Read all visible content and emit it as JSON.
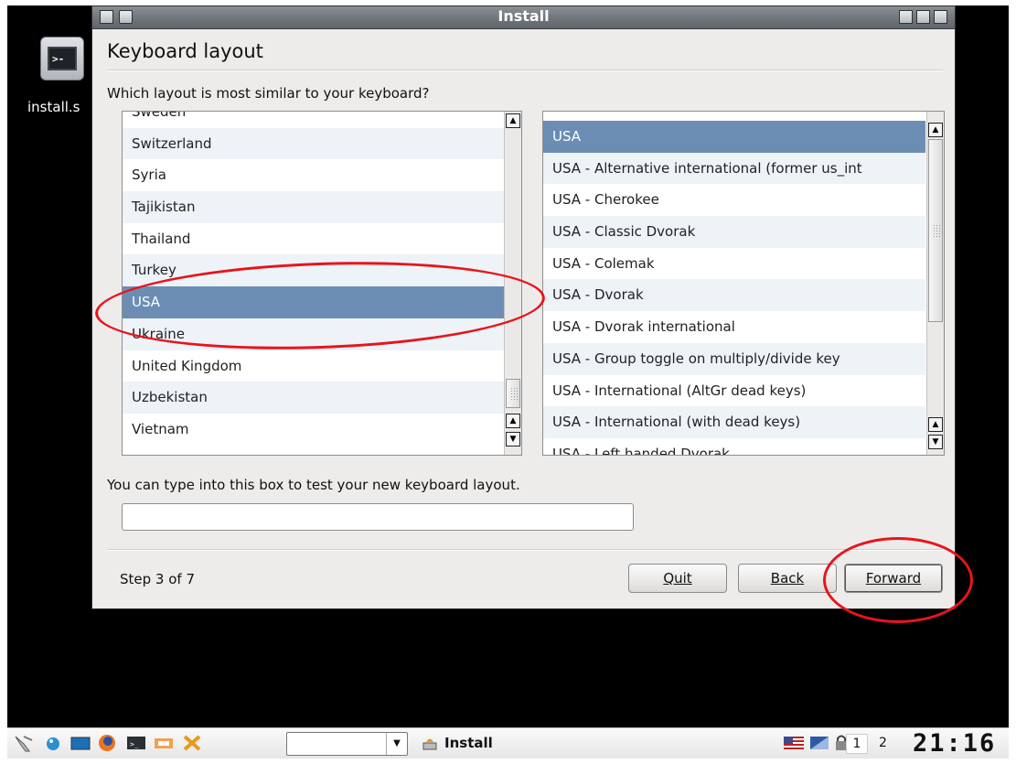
{
  "desktop": {
    "icon_label": "install.s",
    "icon_glyph": ">-"
  },
  "window": {
    "title": "Install",
    "heading": "Keyboard layout",
    "question": "Which layout is most similar to your keyboard?",
    "countries": [
      "Sweden",
      "Switzerland",
      "Syria",
      "Tajikistan",
      "Thailand",
      "Turkey",
      "USA",
      "Ukraine",
      "United Kingdom",
      "Uzbekistan",
      "Vietnam"
    ],
    "selected_country": "USA",
    "variants": [
      "USA",
      "USA - Alternative international (former us_int",
      "USA - Cherokee",
      "USA - Classic Dvorak",
      "USA - Colemak",
      "USA - Dvorak",
      "USA - Dvorak international",
      "USA - Group toggle on multiply/divide key",
      "USA - International (AltGr dead keys)",
      "USA - International (with dead keys)",
      "USA - Left handed Dvorak"
    ],
    "selected_variant": "USA",
    "test_hint": "You can type into this box to test your new keyboard layout.",
    "test_input_value": "",
    "step_text": "Step 3 of 7",
    "buttons": {
      "quit": "Quit",
      "back": "Back",
      "forward": "Forward"
    }
  },
  "taskbar": {
    "task_label": "Install",
    "workspace_1": "1",
    "workspace_2": "2",
    "clock": "21:16",
    "combo_value": ""
  },
  "colors": {
    "selection": "#6b8db4",
    "annotation": "#e8141c",
    "title_bar": "#6d7378"
  }
}
